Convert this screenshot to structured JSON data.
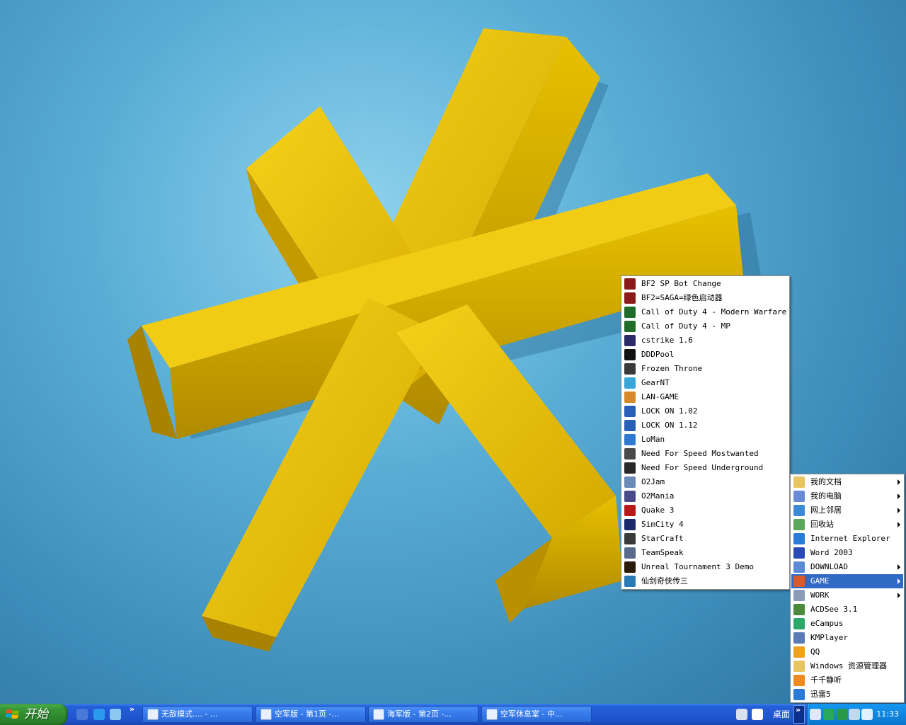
{
  "game_menu": {
    "items": [
      {
        "label": "BF2 SP Bot Change",
        "icon": "bf2-icon",
        "color": "#8b1a1a"
      },
      {
        "label": "BF2=SAGA=绿色启动器",
        "icon": "bf2-icon",
        "color": "#8b1a1a"
      },
      {
        "label": "Call of Duty 4 - Modern Warfare",
        "icon": "cod4-icon",
        "color": "#1f6b2a"
      },
      {
        "label": "Call of Duty 4 - MP",
        "icon": "cod4-icon",
        "color": "#1f6b2a"
      },
      {
        "label": "cstrike 1.6",
        "icon": "counter-strike-icon",
        "color": "#2b2b6a"
      },
      {
        "label": "DDDPool",
        "icon": "pool-ball-icon",
        "color": "#111111"
      },
      {
        "label": "Frozen Throne",
        "icon": "warcraft-icon",
        "color": "#3a3a3a"
      },
      {
        "label": "GearNT",
        "icon": "gear-icon",
        "color": "#3aa6d8"
      },
      {
        "label": "LAN-GAME",
        "icon": "people-icon",
        "color": "#d88a2a"
      },
      {
        "label": "LOCK ON 1.02",
        "icon": "lockon-icon",
        "color": "#2a5fb8"
      },
      {
        "label": "LOCK ON 1.12",
        "icon": "lockon-icon",
        "color": "#2a5fb8"
      },
      {
        "label": "LoMan",
        "icon": "loman-icon",
        "color": "#2f7ad0"
      },
      {
        "label": "Need For Speed Mostwanted",
        "icon": "nfs-icon",
        "color": "#4a4a4a"
      },
      {
        "label": "Need For Speed Underground",
        "icon": "nfs-icon",
        "color": "#2a2a2a"
      },
      {
        "label": "O2Jam",
        "icon": "o2jam-icon",
        "color": "#6a8ab8"
      },
      {
        "label": "O2Mania",
        "icon": "o2mania-icon",
        "color": "#4a4a8a"
      },
      {
        "label": "Quake 3",
        "icon": "quake-icon",
        "color": "#b81a1a"
      },
      {
        "label": "SimCity 4",
        "icon": "simcity-icon",
        "color": "#1a2a6a"
      },
      {
        "label": "StarCraft",
        "icon": "starcraft-icon",
        "color": "#3a3a3a"
      },
      {
        "label": "TeamSpeak",
        "icon": "teamspeak-icon",
        "color": "#5a6a8a"
      },
      {
        "label": "Unreal Tournament 3 Demo",
        "icon": "unreal-icon",
        "color": "#2a1a0a"
      },
      {
        "label": "仙剑奇侠传三",
        "icon": "pal3-icon",
        "color": "#2a7ab8"
      }
    ]
  },
  "main_menu": {
    "items": [
      {
        "label": "我的文档",
        "icon": "folder-documents-icon",
        "color": "#e8c560",
        "submenu": true,
        "selected": false
      },
      {
        "label": "我的电脑",
        "icon": "computer-icon",
        "color": "#6a8ad8",
        "submenu": true,
        "selected": false
      },
      {
        "label": "网上邻居",
        "icon": "network-icon",
        "color": "#3a8ad8",
        "submenu": true,
        "selected": false
      },
      {
        "label": "回收站",
        "icon": "recycle-bin-icon",
        "color": "#5aa85a",
        "submenu": true,
        "selected": false
      },
      {
        "label": "Internet Explorer",
        "icon": "internet-explorer-icon",
        "color": "#2a7ad8",
        "submenu": false,
        "selected": false
      },
      {
        "label": "Word 2003",
        "icon": "word-icon",
        "color": "#2a4ab8",
        "submenu": false,
        "selected": false
      },
      {
        "label": "DOWNLOAD",
        "icon": "download-folder-icon",
        "color": "#5a8ad8",
        "submenu": true,
        "selected": false
      },
      {
        "label": "GAME",
        "icon": "game-folder-icon",
        "color": "#d85a2a",
        "submenu": true,
        "selected": true
      },
      {
        "label": "WORK",
        "icon": "work-folder-icon",
        "color": "#8a9ab8",
        "submenu": true,
        "selected": false
      },
      {
        "label": "ACDSee 3.1",
        "icon": "acdsee-icon",
        "color": "#4a8a3a",
        "submenu": false,
        "selected": false
      },
      {
        "label": "eCampus",
        "icon": "ecampus-icon",
        "color": "#2aa86a",
        "submenu": false,
        "selected": false
      },
      {
        "label": "KMPlayer",
        "icon": "kmplayer-icon",
        "color": "#5a7ab8",
        "submenu": false,
        "selected": false
      },
      {
        "label": "QQ",
        "icon": "qq-penguin-icon",
        "color": "#f0a020",
        "submenu": false,
        "selected": false
      },
      {
        "label": "Windows 资源管理器",
        "icon": "explorer-folder-icon",
        "color": "#e8c560",
        "submenu": false,
        "selected": false
      },
      {
        "label": "千千静听",
        "icon": "ttplayer-icon",
        "color": "#f08a20",
        "submenu": false,
        "selected": false
      },
      {
        "label": "迅雷5",
        "icon": "thunder-icon",
        "color": "#2a7ad8",
        "submenu": false,
        "selected": false
      }
    ]
  },
  "taskbar": {
    "start_label": "开始",
    "quick_launch": [
      {
        "icon": "media-icon",
        "color": "#4a7ad8"
      },
      {
        "icon": "internet-explorer-icon",
        "color": "#2a9af0"
      },
      {
        "icon": "show-desktop-icon",
        "color": "#8ac8f0"
      }
    ],
    "chevron": "»",
    "tasks": [
      {
        "label": "无敌模式.... - ...",
        "icon": "ie-page-icon"
      },
      {
        "label": "空军版 - 第1页 -...",
        "icon": "ie-page-icon"
      },
      {
        "label": "海军版 - 第2页 -...",
        "icon": "ie-page-icon"
      },
      {
        "label": "空军休息室 - 中...",
        "icon": "ie-page-icon"
      }
    ],
    "desktop_label": "桌面",
    "tray_chevron": "»",
    "tray_icons": [
      {
        "icon": "back-arrow-icon",
        "color": "#e0e8f8"
      },
      {
        "icon": "antivirus-icon",
        "color": "#2aa85a"
      },
      {
        "icon": "umbrella-icon",
        "color": "#2a9a4a"
      },
      {
        "icon": "network-connection-icon",
        "color": "#c0d8f0"
      },
      {
        "icon": "shield-icon",
        "color": "#e0f0ff"
      }
    ],
    "clock": "11:33"
  }
}
